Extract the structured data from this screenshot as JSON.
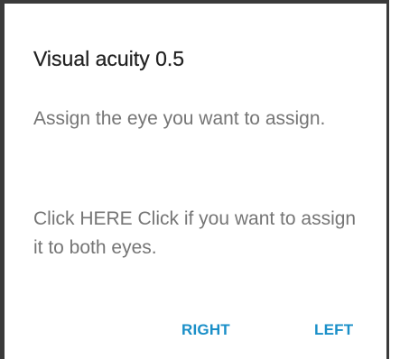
{
  "dialog": {
    "title": "Visual acuity 0.5",
    "message_1": "Assign the eye you want to assign.",
    "message_2": "Click HERE Click if you want to assign it to both eyes.",
    "buttons": {
      "right_label": "RIGHT",
      "left_label": "LEFT"
    },
    "colors": {
      "accent": "#1a8fc8",
      "title": "#212121",
      "body_text": "#757575",
      "background": "#ffffff"
    }
  }
}
